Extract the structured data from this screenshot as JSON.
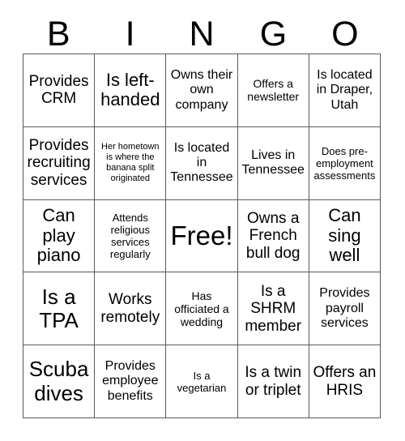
{
  "card": {
    "title": "BINGO",
    "header_letters": [
      "B",
      "I",
      "N",
      "G",
      "O"
    ],
    "columns": 5,
    "rows": 5,
    "colors": {
      "background": "#ffffff",
      "border": "#5a5a5a",
      "text": "#000000"
    },
    "cells": [
      [
        {
          "text": "Provides CRM",
          "size": "l"
        },
        {
          "text": "Is left-handed",
          "size": "xl"
        },
        {
          "text": "Owns their own company",
          "size": "m"
        },
        {
          "text": "Offers a newsletter",
          "size": "s"
        },
        {
          "text": "Is located in Draper, Utah",
          "size": "m"
        }
      ],
      [
        {
          "text": "Provides recruiting services",
          "size": "l"
        },
        {
          "text": "Her hometown is where the banana split originated",
          "size": "xxs"
        },
        {
          "text": "Is located in Tennessee",
          "size": "m"
        },
        {
          "text": "Lives in Tennessee",
          "size": "m"
        },
        {
          "text": "Does pre-employment assessments",
          "size": "xs"
        }
      ],
      [
        {
          "text": "Can play piano",
          "size": "xl"
        },
        {
          "text": "Attends religious services regularly",
          "size": "xs"
        },
        {
          "text": "Free!",
          "size": "free"
        },
        {
          "text": "Owns a French bull dog",
          "size": "l"
        },
        {
          "text": "Can sing well",
          "size": "xl"
        }
      ],
      [
        {
          "text": "Is a TPA",
          "size": "xxl"
        },
        {
          "text": "Works remotely",
          "size": "l"
        },
        {
          "text": "Has officiated a wedding",
          "size": "s"
        },
        {
          "text": "Is a SHRM member",
          "size": "l"
        },
        {
          "text": "Provides payroll services",
          "size": "m"
        }
      ],
      [
        {
          "text": "Scuba dives",
          "size": "xxl"
        },
        {
          "text": "Provides employee benefits",
          "size": "m"
        },
        {
          "text": "Is a vegetarian",
          "size": "xs"
        },
        {
          "text": "Is a twin or triplet",
          "size": "l"
        },
        {
          "text": "Offers an HRIS",
          "size": "l"
        }
      ]
    ]
  }
}
